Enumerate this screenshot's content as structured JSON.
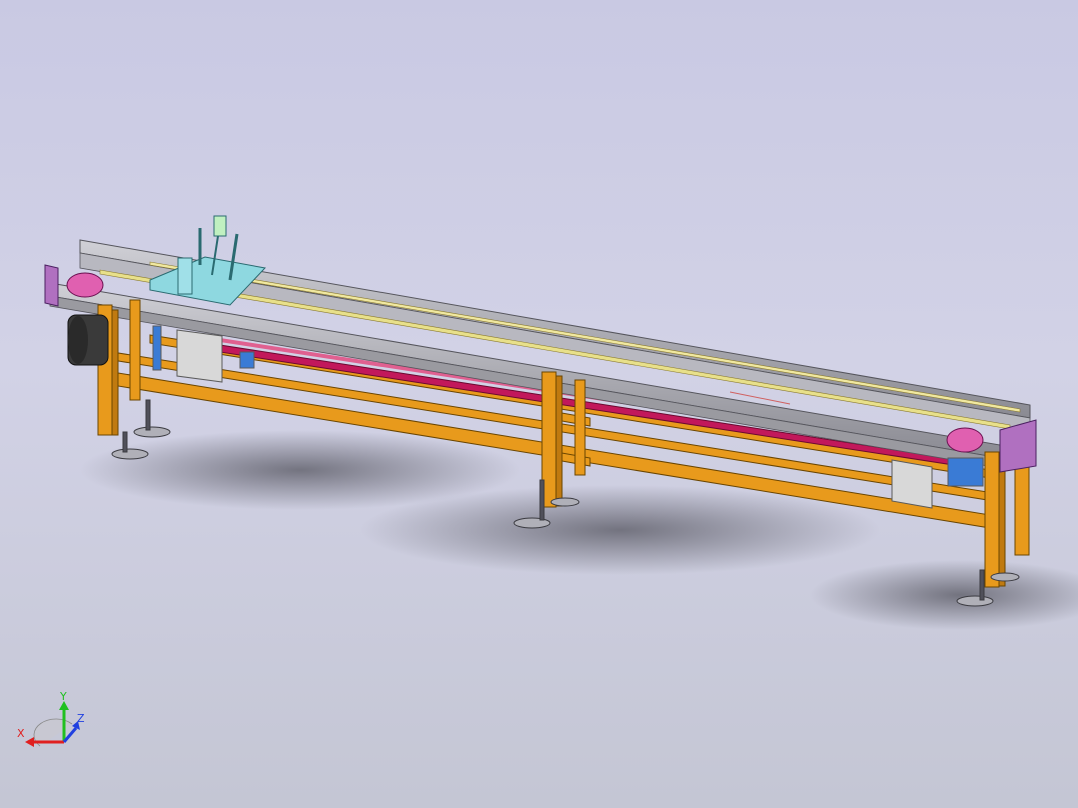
{
  "viewport": {
    "background_top": "#c9c9e3",
    "background_bottom": "#c4c6d4"
  },
  "model": {
    "frame_color": "#e89a1c",
    "rail_color": "#9a9aa0",
    "belt_color": "#e8e08a",
    "underbelt_color": "#c2185b",
    "endplate_color": "#b070c0",
    "bracket_color": "#8ed8e0",
    "motor_color": "#3a3a3a",
    "guard_color": "#d8d8d8",
    "tensioner_color": "#3a7bd5"
  },
  "triad": {
    "x_label": "X",
    "y_label": "Y",
    "z_label": "Z",
    "x_color": "#e02020",
    "y_color": "#20c020",
    "z_color": "#2040e0"
  }
}
